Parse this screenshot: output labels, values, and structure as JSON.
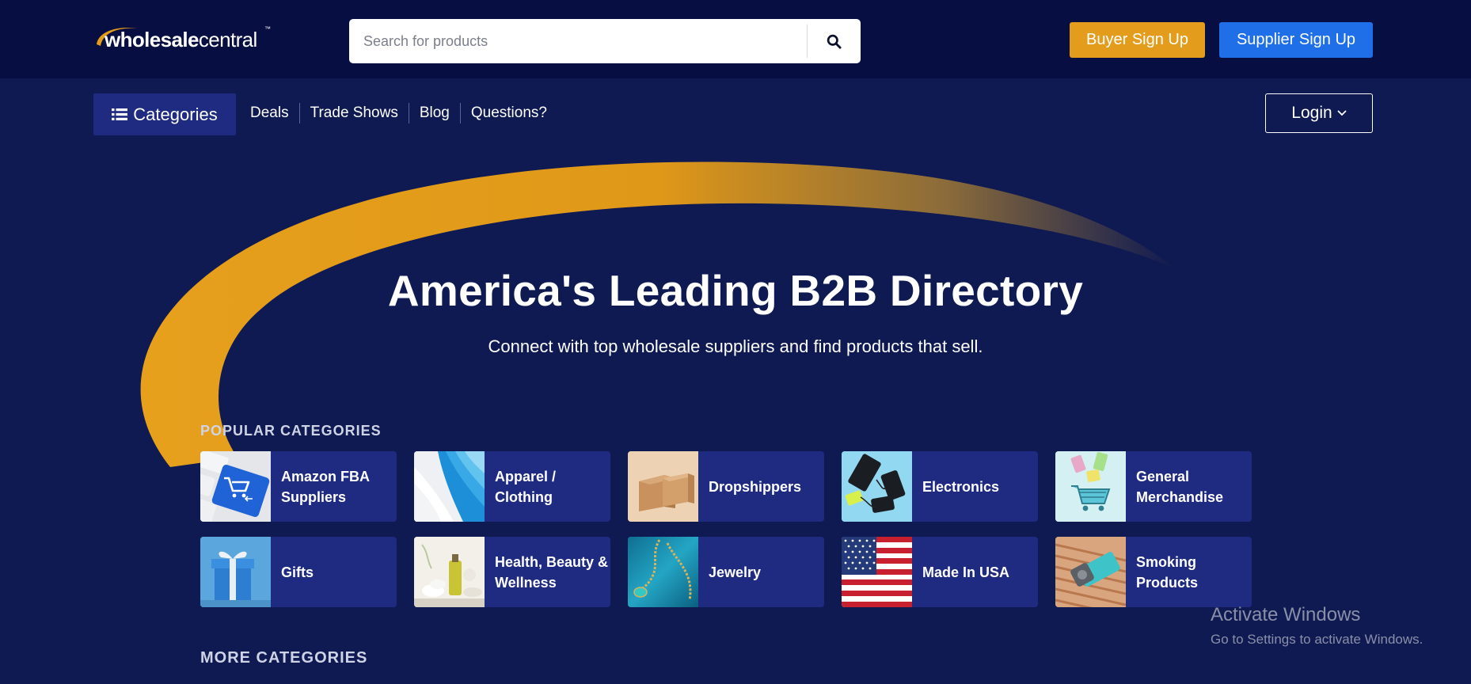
{
  "header": {
    "logo": {
      "part1": "wholesale",
      "part2": "central",
      "tm": "™"
    },
    "search": {
      "placeholder": "Search for products",
      "icon": "search-icon"
    },
    "buyer_signup_label": "Buyer Sign Up",
    "supplier_signup_label": "Supplier Sign Up"
  },
  "colors": {
    "header_bg": "#060e42",
    "page_bg": "#0f1a52",
    "card_bg": "#1f2b80",
    "accent_orange": "#e39c1b",
    "accent_blue": "#1e6fe8"
  },
  "nav": {
    "categories_label": "Categories",
    "categories_icon": "list-icon",
    "items": [
      {
        "label": "Deals"
      },
      {
        "label": "Trade Shows"
      },
      {
        "label": "Blog"
      },
      {
        "label": "Questions?"
      }
    ],
    "login_label": "Login",
    "login_icon": "chevron-down-icon"
  },
  "hero": {
    "title": "America's Leading B2B Directory",
    "subtitle": "Connect with top wholesale suppliers and find products that sell."
  },
  "popular": {
    "label": "POPULAR CATEGORIES",
    "categories": [
      {
        "label": "Amazon FBA Suppliers",
        "icon": "shopping-cart-key-image"
      },
      {
        "label": "Apparel / Clothing",
        "icon": "folded-shirts-image"
      },
      {
        "label": "Dropshippers",
        "icon": "cardboard-boxes-image"
      },
      {
        "label": "Electronics",
        "icon": "power-banks-image"
      },
      {
        "label": "General Merchandise",
        "icon": "shopping-cart-image"
      },
      {
        "label": "Gifts",
        "icon": "gift-box-image"
      },
      {
        "label": "Health, Beauty & Wellness",
        "icon": "spa-bottles-image"
      },
      {
        "label": "Jewelry",
        "icon": "necklace-image"
      },
      {
        "label": "Made In USA",
        "icon": "us-flag-image"
      },
      {
        "label": "Smoking Products",
        "icon": "lighter-image"
      }
    ]
  },
  "more": {
    "label": "MORE CATEGORIES"
  },
  "watermark": {
    "title": "Activate Windows",
    "subtitle": "Go to Settings to activate Windows."
  }
}
